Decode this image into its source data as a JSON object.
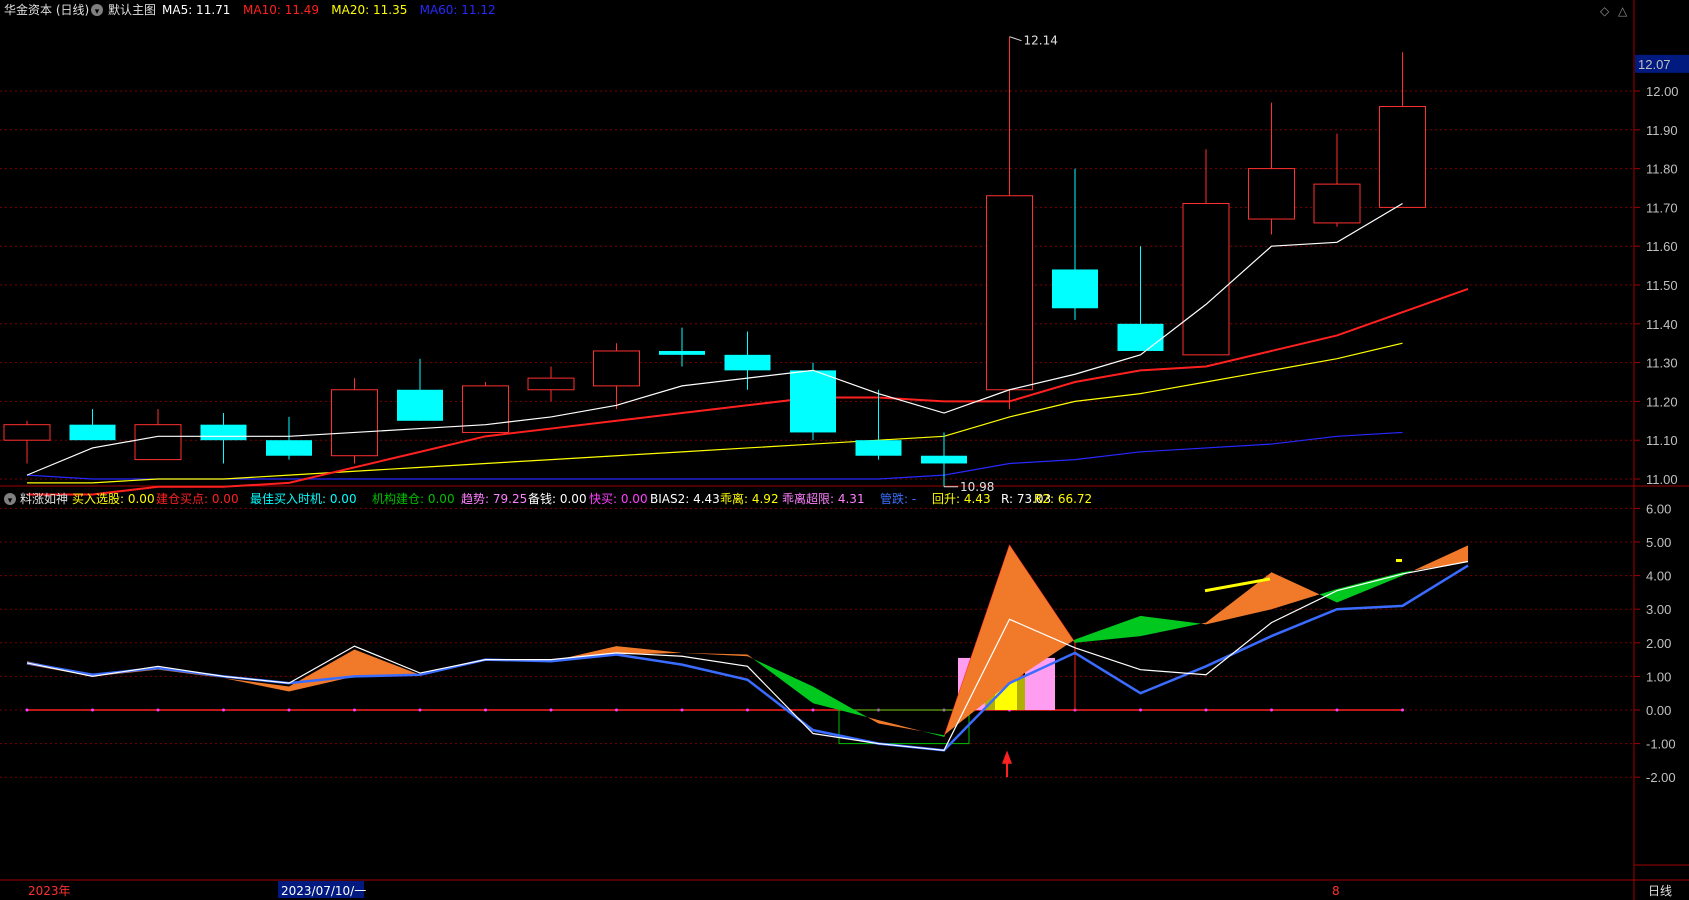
{
  "header": {
    "stock": "华金资本 (日线)",
    "template": "默认主图",
    "ma": [
      {
        "label": "MA5: 11.71",
        "color": "#ffffff"
      },
      {
        "label": "MA10: 11.49",
        "color": "#ff2020"
      },
      {
        "label": "MA20: 11.35",
        "color": "#ffff00"
      },
      {
        "label": "MA60: 11.12",
        "color": "#2828ff"
      }
    ]
  },
  "indicator_header": {
    "name": "料涨如神",
    "items": [
      {
        "label": "买入选股: 0.00",
        "color": "#ffff00"
      },
      {
        "label": "建仓买点: 0.00",
        "color": "#ff2020"
      },
      {
        "label": "最佳买入时机: 0.00",
        "color": "#00ffff"
      },
      {
        "label": "机构建仓: 0.00",
        "color": "#00c000"
      },
      {
        "label": "趋势: 79.25",
        "color": "#ff80ff"
      },
      {
        "label": "备钱: 0.00",
        "color": "#ffffff"
      },
      {
        "label": "快买: 0.00",
        "color": "#ff40ff"
      },
      {
        "label": "BIAS2: 4.43",
        "color": "#ffffff"
      },
      {
        "label": "乖离: 4.92",
        "color": "#ffff00"
      },
      {
        "label": "乖离超限: 4.31",
        "color": "#ff80ff"
      },
      {
        "label": "管跌: -",
        "color": "#3a70ff"
      },
      {
        "label": "回升: 4.43",
        "color": "#ffff00"
      },
      {
        "label": "R: 73.03",
        "color": "#ffffff"
      },
      {
        "label": "R2: 66.72",
        "color": "#ffff00"
      }
    ]
  },
  "price_axis": {
    "ticks": [
      "12.00",
      "11.90",
      "11.80",
      "11.70",
      "11.60",
      "11.50",
      "11.40",
      "11.30",
      "11.20",
      "11.10",
      "11.00"
    ],
    "current": "12.07",
    "ylim": [
      10.9,
      12.2
    ]
  },
  "indicator_axis": {
    "ticks": [
      "6.00",
      "5.00",
      "4.00",
      "3.00",
      "2.00",
      "1.00",
      "0.00",
      "-1.00",
      "-2.00"
    ],
    "ylim": [
      -2.5,
      6.4
    ]
  },
  "annotations": {
    "high": "12.14",
    "low": "10.98"
  },
  "bottom_axis": {
    "year": "2023年",
    "date_cursor": "2023/07/10/一",
    "month_mark": "8",
    "period": "日线"
  },
  "colors": {
    "up": "#ff3030",
    "down": "#00ffff",
    "ma5": "#ffffff",
    "ma10": "#ff2020",
    "ma20": "#ffff00",
    "ma60": "#2828ff",
    "grid": "#7a0000",
    "orange": "#f07a2a",
    "green": "#00c81e",
    "blue_line": "#3a6cff"
  },
  "chart_data": {
    "type": "candlestick",
    "candles": [
      {
        "o": 11.1,
        "h": 11.15,
        "l": 11.04,
        "c": 11.14,
        "up": true
      },
      {
        "o": 11.14,
        "h": 11.18,
        "l": 11.1,
        "c": 11.1,
        "up": false
      },
      {
        "o": 11.05,
        "h": 11.18,
        "l": 11.05,
        "c": 11.14,
        "up": true
      },
      {
        "o": 11.14,
        "h": 11.17,
        "l": 11.04,
        "c": 11.1,
        "up": false
      },
      {
        "o": 11.1,
        "h": 11.16,
        "l": 11.05,
        "c": 11.06,
        "up": false
      },
      {
        "o": 11.06,
        "h": 11.26,
        "l": 11.04,
        "c": 11.23,
        "up": true
      },
      {
        "o": 11.23,
        "h": 11.31,
        "l": 11.15,
        "c": 11.15,
        "up": false
      },
      {
        "o": 11.12,
        "h": 11.25,
        "l": 11.12,
        "c": 11.24,
        "up": true
      },
      {
        "o": 11.23,
        "h": 11.29,
        "l": 11.2,
        "c": 11.26,
        "up": true
      },
      {
        "o": 11.24,
        "h": 11.35,
        "l": 11.18,
        "c": 11.33,
        "up": true
      },
      {
        "o": 11.33,
        "h": 11.39,
        "l": 11.29,
        "c": 11.32,
        "up": false
      },
      {
        "o": 11.32,
        "h": 11.38,
        "l": 11.23,
        "c": 11.28,
        "up": false
      },
      {
        "o": 11.28,
        "h": 11.3,
        "l": 11.1,
        "c": 11.12,
        "up": false
      },
      {
        "o": 11.1,
        "h": 11.23,
        "l": 11.05,
        "c": 11.06,
        "up": false
      },
      {
        "o": 11.06,
        "h": 11.12,
        "l": 10.98,
        "c": 11.04,
        "up": false
      },
      {
        "o": 11.23,
        "h": 12.14,
        "l": 11.18,
        "c": 11.73,
        "up": true
      },
      {
        "o": 11.54,
        "h": 11.8,
        "l": 11.41,
        "c": 11.44,
        "up": false
      },
      {
        "o": 11.4,
        "h": 11.6,
        "l": 11.33,
        "c": 11.33,
        "up": false
      },
      {
        "o": 11.32,
        "h": 11.85,
        "l": 11.32,
        "c": 11.71,
        "up": true
      },
      {
        "o": 11.67,
        "h": 11.97,
        "l": 11.63,
        "c": 11.8,
        "up": true
      },
      {
        "o": 11.66,
        "h": 11.89,
        "l": 11.65,
        "c": 11.76,
        "up": true
      },
      {
        "o": 11.7,
        "h": 12.1,
        "l": 11.7,
        "c": 11.96,
        "up": true
      }
    ],
    "ma5": [
      11.01,
      11.08,
      11.11,
      11.11,
      11.11,
      11.12,
      11.13,
      11.14,
      11.16,
      11.19,
      11.24,
      11.26,
      11.28,
      11.22,
      11.17,
      11.23,
      11.27,
      11.32,
      11.45,
      11.6,
      11.61,
      11.71
    ],
    "ma10": [
      10.96,
      10.96,
      10.98,
      10.98,
      10.99,
      11.03,
      11.07,
      11.11,
      11.13,
      11.15,
      11.17,
      11.19,
      11.21,
      11.21,
      11.2,
      11.2,
      11.25,
      11.28,
      11.29,
      11.33,
      11.37,
      11.43,
      11.49
    ],
    "ma20": [
      10.99,
      10.99,
      11.0,
      11.0,
      11.01,
      11.02,
      11.03,
      11.04,
      11.05,
      11.06,
      11.07,
      11.08,
      11.09,
      11.1,
      11.11,
      11.16,
      11.2,
      11.22,
      11.25,
      11.28,
      11.31,
      11.35
    ],
    "ma60": [
      11.01,
      11.0,
      11.0,
      11.0,
      11.0,
      11.0,
      11.0,
      11.0,
      11.0,
      11.0,
      11.0,
      11.0,
      11.0,
      11.0,
      11.01,
      11.04,
      11.05,
      11.07,
      11.08,
      11.09,
      11.11,
      11.12
    ],
    "ind_white": [
      1.4,
      1.0,
      1.3,
      1.0,
      0.8,
      1.9,
      1.1,
      1.5,
      1.5,
      1.7,
      1.6,
      1.3,
      -0.7,
      -1.0,
      -1.2,
      2.7,
      1.85,
      1.2,
      1.05,
      2.6,
      3.55,
      4.05,
      4.42
    ],
    "ind_orange": [
      1.45,
      1.05,
      1.25,
      0.95,
      0.7,
      1.8,
      1.05,
      1.5,
      1.45,
      1.9,
      1.7,
      1.65,
      0.2,
      -0.3,
      -0.8,
      4.9,
      2.0,
      2.2,
      2.6,
      4.1,
      3.2,
      4.0,
      4.9
    ],
    "ind_green": [
      1.35,
      1.0,
      1.2,
      0.95,
      0.55,
      1.0,
      1.05,
      1.5,
      1.45,
      1.65,
      1.7,
      1.6,
      0.7,
      -0.4,
      -0.75,
      0.8,
      2.1,
      2.8,
      2.55,
      3.0,
      3.6,
      4.1,
      4.4
    ],
    "ind_blue": [
      1.4,
      1.05,
      1.25,
      1.0,
      0.8,
      1.0,
      1.05,
      1.5,
      1.45,
      1.65,
      1.35,
      0.9,
      -0.6,
      -1.0,
      -1.2,
      0.8,
      1.7,
      0.5,
      1.3,
      2.2,
      3.0,
      3.1,
      4.3
    ]
  }
}
